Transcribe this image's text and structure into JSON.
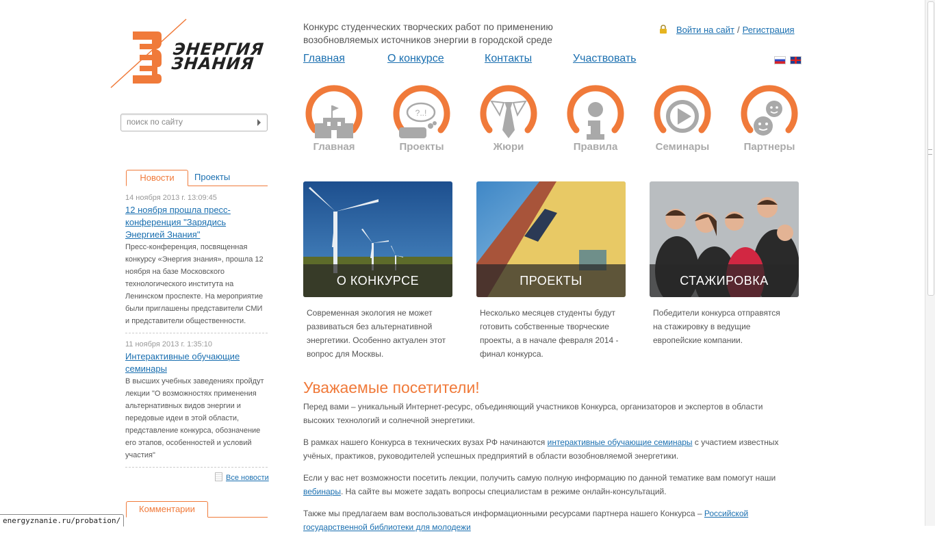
{
  "logo": {
    "line1": "ЭНЕРГИЯ",
    "line2": "ЗНАНИЯ",
    "accent": "#f07a3a"
  },
  "header": {
    "tagline": "Конкурс студенческих творческих работ по применению возобновляемых источников энергии в городской среде",
    "login": "Войти на сайт",
    "separator": "/",
    "register": "Регистрация"
  },
  "nav": [
    "Главная",
    "О конкурсе",
    "Контакты",
    "Участвовать"
  ],
  "search": {
    "placeholder": "поиск по сайту"
  },
  "icons": [
    {
      "label": "Главная",
      "icon": "building-icon"
    },
    {
      "label": "Проекты",
      "icon": "projects-icon"
    },
    {
      "label": "Жюри",
      "icon": "tie-icon"
    },
    {
      "label": "Правила",
      "icon": "info-icon"
    },
    {
      "label": "Семинары",
      "icon": "play-icon"
    },
    {
      "label": "Партнеры",
      "icon": "partners-icon"
    }
  ],
  "sidebar": {
    "tabs": [
      "Новости",
      "Проекты"
    ],
    "news": [
      {
        "date": "14 ноября 2013 г. 13:09:45",
        "title": "12 ноября прошла пресс-конференция \"Зарядись Энергией Знания\"",
        "text": "Пресс-конференция, посвященная конкурсу «Энергия знания», прошла 12 ноября на базе Московского технологического института на Ленинском проспекте. На мероприятие были приглашены представители СМИ и представители общественности."
      },
      {
        "date": "11 ноября 2013 г. 1:35:10",
        "title": "Интерактивные обучающие семинары",
        "text": "В высших учебных заведениях пройдут лекции \"О возможностях применения альтернативных видов энергии и передовые идеи в этой области, представление конкурса, обозначение его этапов, особенностей и условий участия\""
      }
    ],
    "all_news": "Все новости",
    "comments_tab": "Комментарии"
  },
  "cards": [
    {
      "caption": "О КОНКУРСЕ",
      "text": "Современная экология не может развиваться без альтернативной энергетики. Особенно актуален этот вопрос для Москвы."
    },
    {
      "caption": "ПРОЕКТЫ",
      "text": "Несколько месяцев студенты будут готовить собственные творческие проекты, а в начале февраля 2014 - финал конкурса."
    },
    {
      "caption": "СТАЖИРОВКА",
      "text": "Победители конкурса отправятся на стажировку в ведущие европейские компании."
    }
  ],
  "article": {
    "heading": "Уважаемые посетители!",
    "p1": "Перед вами – уникальный Интернет-ресурс, объединяющий участников Конкурса, организаторов и экспертов в области высоких технологий и солнечной энергетики.",
    "p2_before": "В рамках нашего Конкурса в технических вузах РФ начинаются ",
    "p2_link": "интерактивные обучающие семинары",
    "p2_after": " с участием известных учёных, практиков, руководителей успешных предприятий в области возобновляемой энергетики.",
    "p3_before": "Если у вас нет возможности посетить лекции, получить самую полную информацию по данной тематике вам помогут наши ",
    "p3_link": "вебинары",
    "p3_after": ". На сайте вы можете задать вопросы специалистам в режиме онлайн-консультаций.",
    "p4_before": "Также мы предлагаем вам воспользоваться информационными ресурсами партнера нашего Конкурса – ",
    "p4_link": "Российской государственной библиотеки для молодежи"
  },
  "status_url": "energyznanie.ru/probation/"
}
